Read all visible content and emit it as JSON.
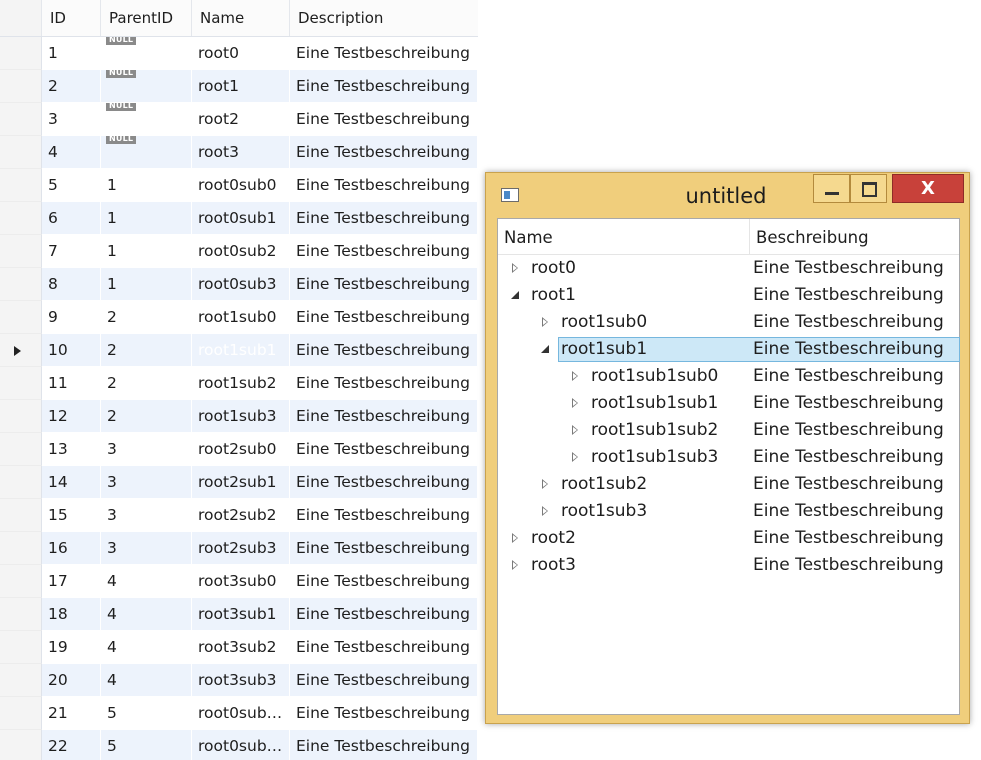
{
  "grid": {
    "columns": [
      "ID",
      "ParentID",
      "Name",
      "Description"
    ],
    "null_label": "NULL",
    "rows": [
      {
        "id": "1",
        "parent": null,
        "name": "root0",
        "desc": "Eine Testbeschreibung"
      },
      {
        "id": "2",
        "parent": null,
        "name": "root1",
        "desc": "Eine Testbeschreibung"
      },
      {
        "id": "3",
        "parent": null,
        "name": "root2",
        "desc": "Eine Testbeschreibung"
      },
      {
        "id": "4",
        "parent": null,
        "name": "root3",
        "desc": "Eine Testbeschreibung"
      },
      {
        "id": "5",
        "parent": "1",
        "name": "root0sub0",
        "desc": "Eine Testbeschreibung"
      },
      {
        "id": "6",
        "parent": "1",
        "name": "root0sub1",
        "desc": "Eine Testbeschreibung"
      },
      {
        "id": "7",
        "parent": "1",
        "name": "root0sub2",
        "desc": "Eine Testbeschreibung"
      },
      {
        "id": "8",
        "parent": "1",
        "name": "root0sub3",
        "desc": "Eine Testbeschreibung"
      },
      {
        "id": "9",
        "parent": "2",
        "name": "root1sub0",
        "desc": "Eine Testbeschreibung"
      },
      {
        "id": "10",
        "parent": "2",
        "name": "root1sub1",
        "desc": "Eine Testbeschreibung",
        "current": true
      },
      {
        "id": "11",
        "parent": "2",
        "name": "root1sub2",
        "desc": "Eine Testbeschreibung"
      },
      {
        "id": "12",
        "parent": "2",
        "name": "root1sub3",
        "desc": "Eine Testbeschreibung"
      },
      {
        "id": "13",
        "parent": "3",
        "name": "root2sub0",
        "desc": "Eine Testbeschreibung"
      },
      {
        "id": "14",
        "parent": "3",
        "name": "root2sub1",
        "desc": "Eine Testbeschreibung"
      },
      {
        "id": "15",
        "parent": "3",
        "name": "root2sub2",
        "desc": "Eine Testbeschreibung"
      },
      {
        "id": "16",
        "parent": "3",
        "name": "root2sub3",
        "desc": "Eine Testbeschreibung"
      },
      {
        "id": "17",
        "parent": "4",
        "name": "root3sub0",
        "desc": "Eine Testbeschreibung"
      },
      {
        "id": "18",
        "parent": "4",
        "name": "root3sub1",
        "desc": "Eine Testbeschreibung"
      },
      {
        "id": "19",
        "parent": "4",
        "name": "root3sub2",
        "desc": "Eine Testbeschreibung"
      },
      {
        "id": "20",
        "parent": "4",
        "name": "root3sub3",
        "desc": "Eine Testbeschreibung"
      },
      {
        "id": "21",
        "parent": "5",
        "name": "root0sub…",
        "desc": "Eine Testbeschreibung"
      },
      {
        "id": "22",
        "parent": "5",
        "name": "root0sub…",
        "desc": "Eine Testbeschreibung"
      }
    ]
  },
  "window": {
    "title": "untitled",
    "icon": "window-app-icon",
    "close_glyph": "X",
    "columns": {
      "name": "Name",
      "desc": "Beschreibung"
    },
    "tree": [
      {
        "name": "root0",
        "desc": "Eine Testbeschreibung",
        "level": 0,
        "state": "collapsed"
      },
      {
        "name": "root1",
        "desc": "Eine Testbeschreibung",
        "level": 0,
        "state": "expanded"
      },
      {
        "name": "root1sub0",
        "desc": "Eine Testbeschreibung",
        "level": 1,
        "state": "collapsed"
      },
      {
        "name": "root1sub1",
        "desc": "Eine Testbeschreibung",
        "level": 1,
        "state": "expanded",
        "selected": true
      },
      {
        "name": "root1sub1sub0",
        "desc": "Eine Testbeschreibung",
        "level": 2,
        "state": "collapsed"
      },
      {
        "name": "root1sub1sub1",
        "desc": "Eine Testbeschreibung",
        "level": 2,
        "state": "collapsed"
      },
      {
        "name": "root1sub1sub2",
        "desc": "Eine Testbeschreibung",
        "level": 2,
        "state": "collapsed"
      },
      {
        "name": "root1sub1sub3",
        "desc": "Eine Testbeschreibung",
        "level": 2,
        "state": "collapsed"
      },
      {
        "name": "root1sub2",
        "desc": "Eine Testbeschreibung",
        "level": 1,
        "state": "collapsed"
      },
      {
        "name": "root1sub3",
        "desc": "Eine Testbeschreibung",
        "level": 1,
        "state": "collapsed"
      },
      {
        "name": "root2",
        "desc": "Eine Testbeschreibung",
        "level": 0,
        "state": "collapsed"
      },
      {
        "name": "root3",
        "desc": "Eine Testbeschreibung",
        "level": 0,
        "state": "collapsed"
      }
    ]
  },
  "colors": {
    "grid_alt_row": "#edf3fc",
    "grid_selection": "#3399ff",
    "window_frame": "#f0ce7c",
    "close_button": "#c8413a",
    "tree_selection": "#cde8f7"
  }
}
